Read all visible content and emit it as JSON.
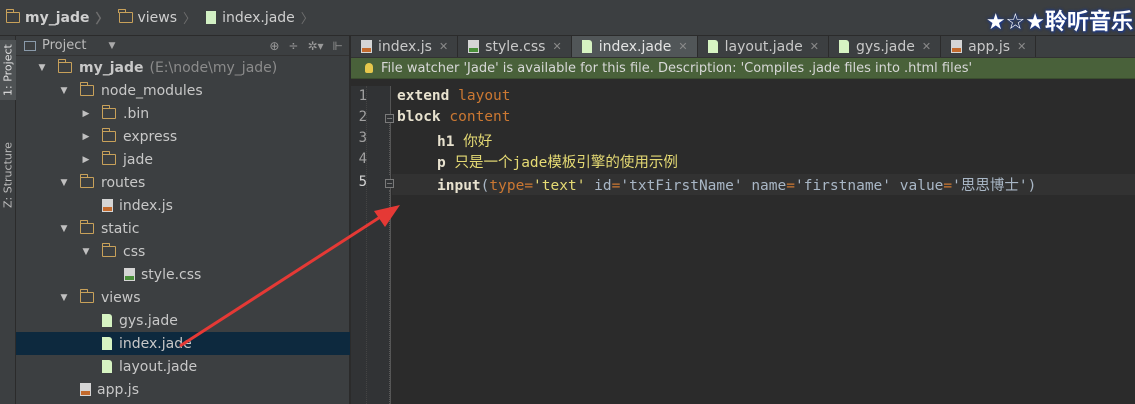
{
  "breadcrumb": [
    {
      "label": "my_jade",
      "icon": "folder-icon"
    },
    {
      "label": "views",
      "icon": "folder-icon"
    },
    {
      "label": "index.jade",
      "icon": "jade-file-icon"
    }
  ],
  "watermark": "★☆★聆听音乐",
  "toolstrip": {
    "project_tab": "1: Project",
    "structure_tab": "Z: Structure"
  },
  "project_panel": {
    "title": "Project",
    "tree": [
      {
        "label": "my_jade",
        "suffix": "(E:\\node\\my_jade)",
        "type": "folder",
        "expanded": true
      },
      {
        "label": "node_modules",
        "type": "folder",
        "expanded": true
      },
      {
        "label": ".bin",
        "type": "folder",
        "expanded": false
      },
      {
        "label": "express",
        "type": "folder",
        "expanded": false
      },
      {
        "label": "jade",
        "type": "folder",
        "expanded": false
      },
      {
        "label": "routes",
        "type": "folder",
        "expanded": true
      },
      {
        "label": "index.js",
        "type": "js"
      },
      {
        "label": "static",
        "type": "folder",
        "expanded": true
      },
      {
        "label": "css",
        "type": "folder",
        "expanded": true
      },
      {
        "label": "style.css",
        "type": "css"
      },
      {
        "label": "views",
        "type": "folder",
        "expanded": true
      },
      {
        "label": "gys.jade",
        "type": "jade"
      },
      {
        "label": "index.jade",
        "type": "jade",
        "selected": true
      },
      {
        "label": "layout.jade",
        "type": "jade"
      },
      {
        "label": "app.js",
        "type": "js"
      }
    ]
  },
  "tabs": [
    {
      "label": "index.js",
      "icon": "js-file-icon"
    },
    {
      "label": "style.css",
      "icon": "css-file-icon"
    },
    {
      "label": "index.jade",
      "icon": "jade-file-icon",
      "active": true
    },
    {
      "label": "layout.jade",
      "icon": "jade-file-icon"
    },
    {
      "label": "gys.jade",
      "icon": "jade-file-icon"
    },
    {
      "label": "app.js",
      "icon": "js-file-icon"
    }
  ],
  "banner": "File watcher 'Jade' is available for this file. Description: 'Compiles .jade files into .html files'",
  "code": {
    "line_numbers": [
      "1",
      "2",
      "3",
      "4",
      "5"
    ],
    "current_line": 5,
    "line1": {
      "kw": "extend",
      "id": "layout"
    },
    "line2": {
      "kw": "block",
      "id": "content"
    },
    "line3": {
      "kw": "h1",
      "text": "你好"
    },
    "line4": {
      "kw": "p",
      "text": "只是一个jade模板引擎的使用示例"
    },
    "line5": {
      "kw": "input",
      "open": "(",
      "a1": "type",
      "v1": "'text'",
      "a2": "id",
      "v2": "'txtFirstName'",
      "a3": "name",
      "v3": "'firstname'",
      "a4": "value",
      "v4": "'思思博士'",
      "close": ")",
      "eq": "="
    }
  },
  "colors": {
    "background": "#2b2b2b",
    "panel": "#3c3f41",
    "selection": "#0d293e",
    "banner": "#49613a",
    "annotation_arrow": "#e53935"
  }
}
